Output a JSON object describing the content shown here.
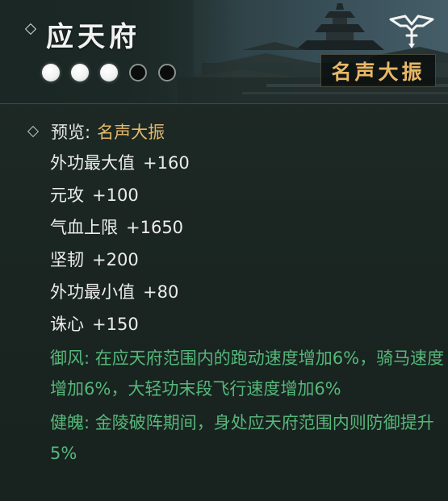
{
  "header": {
    "title": "应天府",
    "fame_level": {
      "filled": 3,
      "total": 5
    },
    "badge": "名声大振",
    "emblem_icon": "winged-sword-icon"
  },
  "preview": {
    "label": "预览:",
    "value": "名声大振"
  },
  "stats": [
    {
      "name": "外功最大值",
      "value": "+160"
    },
    {
      "name": "元攻",
      "value": "+100"
    },
    {
      "name": "气血上限",
      "value": "+1650"
    },
    {
      "name": "坚韧",
      "value": "+200"
    },
    {
      "name": "外功最小值",
      "value": "+80"
    },
    {
      "name": "诛心",
      "value": "+150"
    }
  ],
  "effects": [
    "御风: 在应天府范围内的跑动速度增加6%，骑马速度增加6%，大轻功末段飞行速度增加6%",
    "健魄: 金陵破阵期间，身处应天府范围内则防御提升5%"
  ],
  "colors": {
    "title": "#f2f2f2",
    "badge": "#e9b865",
    "preview_value": "#e3b86a",
    "stat_text": "#ececec",
    "effect_text": "#56b77b",
    "background": "#1d2925"
  }
}
